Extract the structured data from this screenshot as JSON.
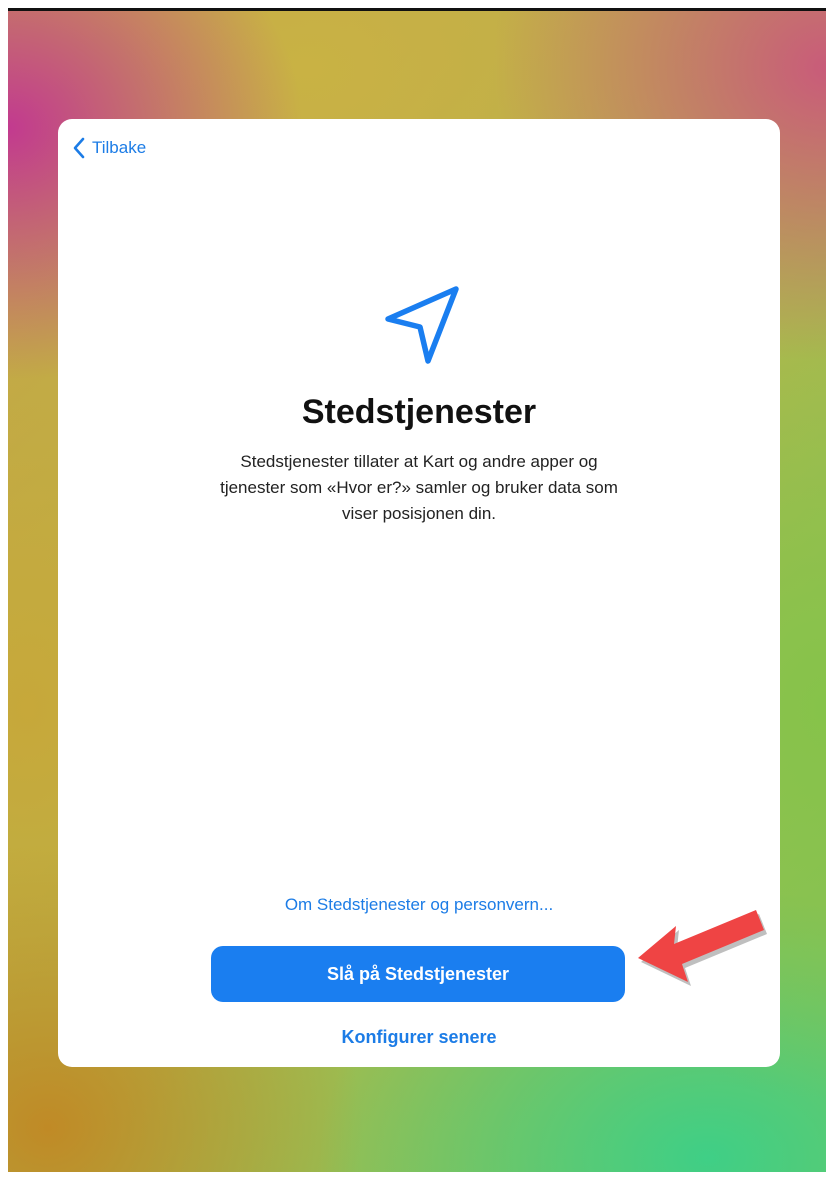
{
  "header": {
    "back_label": "Tilbake"
  },
  "main": {
    "title": "Stedstjenester",
    "description": "Stedstjenester tillater at Kart og andre apper og tjenester som «Hvor er?» samler og bruker data som viser posisjonen din.",
    "icon": "location-arrow-icon"
  },
  "footer": {
    "privacy_link": "Om Stedstjenester og personvern...",
    "primary_button": "Slå på Stedstjenester",
    "secondary_link": "Konfigurer senere"
  },
  "colors": {
    "accent": "#1a7ef0",
    "annotation_arrow": "#ef4444"
  }
}
